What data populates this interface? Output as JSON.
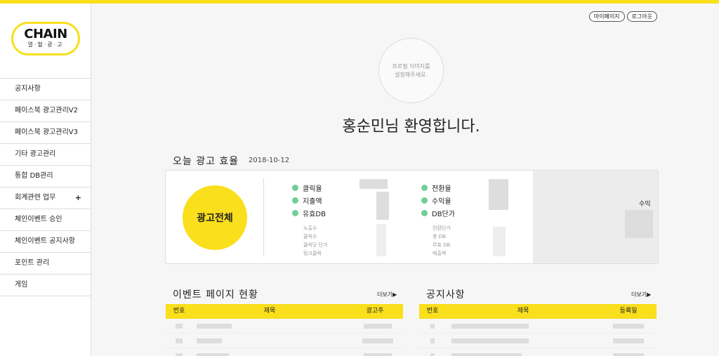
{
  "logo": {
    "main": "CHAIN",
    "sub": "열·혈·광·고"
  },
  "sidebar": {
    "items": [
      {
        "label": "공지사항"
      },
      {
        "label": "페이스북 광고관리V2"
      },
      {
        "label": "페이스북 광고관리V3"
      },
      {
        "label": "기타 광고관리"
      },
      {
        "label": "통합 DB관리"
      },
      {
        "label": "회계관련 업무",
        "expand": "+"
      },
      {
        "label": "체인이벤트 승인"
      },
      {
        "label": "체인이벤트 공지사항"
      },
      {
        "label": "포인트 관리"
      },
      {
        "label": "게임"
      }
    ]
  },
  "header": {
    "mypage": "마이페이지",
    "logout": "로그아웃"
  },
  "profile": {
    "line1": "프로필 이미지를",
    "line2": "설정해주세요."
  },
  "welcome": "홍순민님 환영합니다.",
  "performance": {
    "title": "오늘 광고 효율",
    "date": "2018-10-12",
    "circle": "광고전체",
    "left_metrics": [
      "클릭율",
      "지출액",
      "유효DB"
    ],
    "left_sub": [
      "노출수",
      "클릭수",
      "클릭당 단가",
      "링크클릭"
    ],
    "right_metrics": [
      "전환율",
      "수익율",
      "DB단가"
    ],
    "right_sub": [
      "전환단가",
      "총 DB",
      "무효 DB",
      "매출액"
    ],
    "profit_label": "수익"
  },
  "events": {
    "title": "이벤트 페이지 현황",
    "more": "더보기▶",
    "columns": [
      "번호",
      "제목",
      "광고주"
    ]
  },
  "notices": {
    "title": "공지사항",
    "more": "더보기▶",
    "columns": [
      "번호",
      "제목",
      "등록일"
    ]
  },
  "colors": {
    "accent": "#f9df1c",
    "dot": "#6fcf97"
  }
}
